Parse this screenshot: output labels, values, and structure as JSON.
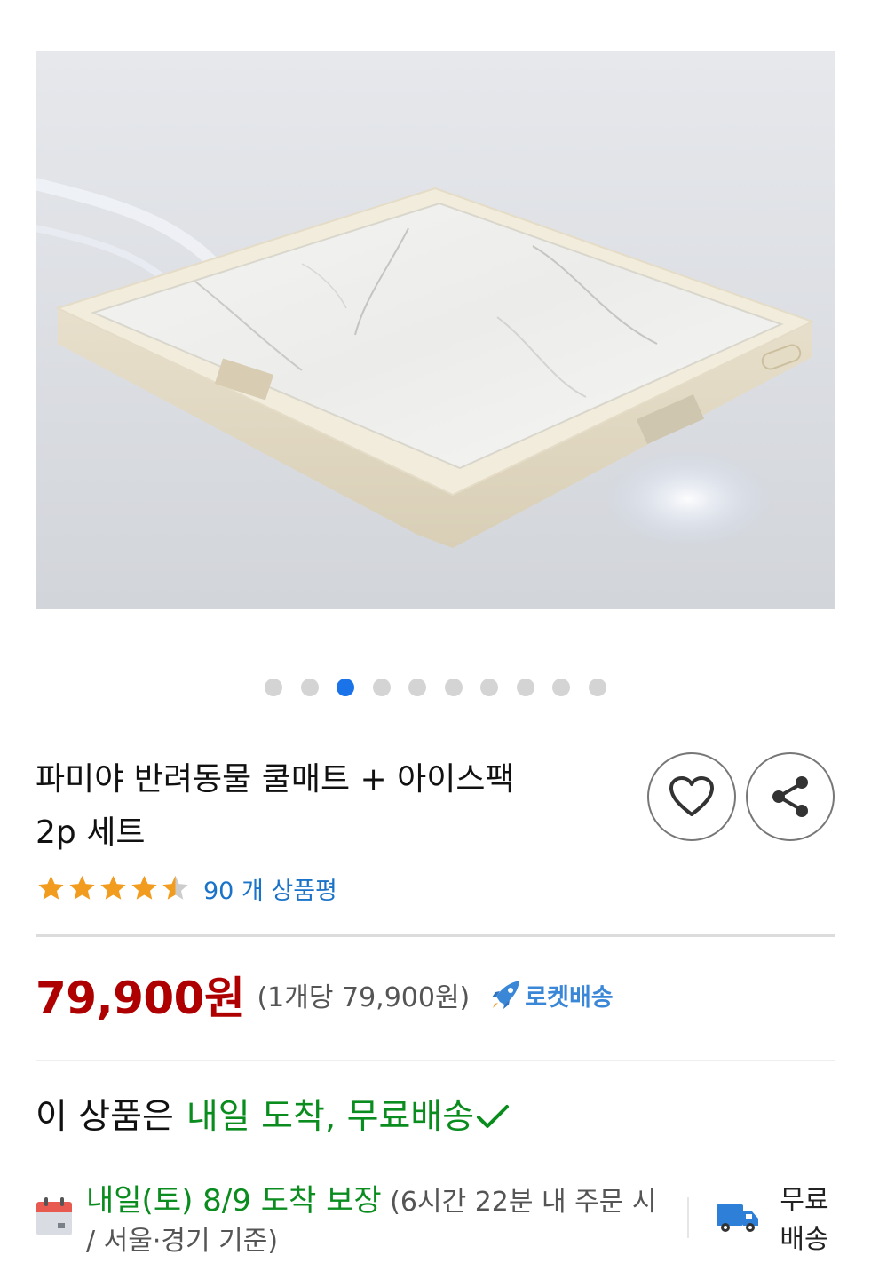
{
  "product": {
    "title_line1": "파미야 반려동물 쿨매트 + 아이스팩",
    "title_line2": "2p 세트",
    "image_alt": "marble-cooling-mat-image"
  },
  "carousel": {
    "total": 10,
    "active_index": 2
  },
  "rating": {
    "stars": 4.5,
    "max": 5,
    "review_count_label": "90 개 상품평"
  },
  "actions": {
    "wish_icon": "heart-icon",
    "share_icon": "share-icon"
  },
  "price": {
    "value": "79,900원",
    "unit_price": "(1개당 79,900원)",
    "rocket_label": "로켓배송"
  },
  "delivery": {
    "summary_prefix": "이 상품은",
    "summary_highlight": "내일 도착, 무료배송",
    "arrival_guarantee": "내일(토) 8/9 도착 보장",
    "arrival_note": " (6시간 22분 내 주문 시 / 서울·경기 기준)",
    "free_shipping_line1": "무료",
    "free_shipping_line2": "배송"
  },
  "colors": {
    "price": "#ae0000",
    "accent_blue": "#1a73e8",
    "delivery_green": "#0a8c1e",
    "review_link": "#1a73c8",
    "star": "#f29c1f"
  }
}
